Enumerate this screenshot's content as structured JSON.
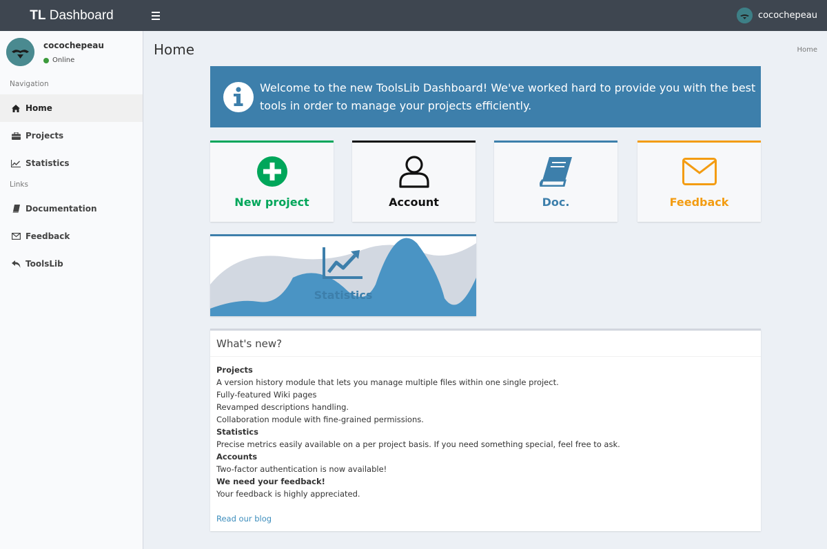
{
  "topbar": {
    "brand_bold": "TL",
    "brand_rest": " Dashboard",
    "username": "cocochepeau",
    "menu_icon": "hamburger-icon"
  },
  "sidebar": {
    "user": {
      "name": "cocochepeau",
      "status": "Online",
      "status_color": "#3c9a3c"
    },
    "nav_header": "Navigation",
    "nav_items": [
      {
        "label": "Home",
        "icon": "home-icon",
        "active": true
      },
      {
        "label": "Projects",
        "icon": "briefcase-icon"
      },
      {
        "label": "Statistics",
        "icon": "line-chart-icon"
      }
    ],
    "links_header": "Links",
    "link_items": [
      {
        "label": "Documentation",
        "icon": "book-icon"
      },
      {
        "label": "Feedback",
        "icon": "envelope-icon"
      },
      {
        "label": "ToolsLib",
        "icon": "reply-icon"
      }
    ]
  },
  "page": {
    "title": "Home",
    "breadcrumb": "Home"
  },
  "welcome": {
    "line1": "Welcome to the new ToolsLib Dashboard! We've worked hard to provide you with the best",
    "line2": "tools in order to manage your projects efficiently.",
    "icon": "info-circle-icon",
    "color": "#3d7fab"
  },
  "cards": [
    {
      "label": "New project",
      "icon": "plus-circle-icon",
      "color": "#00a65a"
    },
    {
      "label": "Account",
      "icon": "user-icon",
      "color": "#111111"
    },
    {
      "label": "Doc.",
      "icon": "book-icon",
      "color": "#3d7fab"
    },
    {
      "label": "Feedback",
      "icon": "envelope-icon",
      "color": "#f39c12"
    }
  ],
  "stats_card": {
    "label": "Statistics",
    "icon": "area-chart-icon",
    "color": "#3d7fab"
  },
  "news": {
    "title": "What's new?",
    "sections": [
      {
        "heading": "Projects",
        "lines": [
          "A version history module that lets you manage multiple files within one single project.",
          "Fully-featured Wiki pages",
          "Revamped descriptions handling.",
          "Collaboration module with fine-grained permissions."
        ]
      },
      {
        "heading": "Statistics",
        "lines": [
          "Precise metrics easily available on a per project basis. If you need something special, feel free to ask."
        ]
      },
      {
        "heading": "Accounts",
        "lines": [
          "Two-factor authentication is now available!"
        ]
      },
      {
        "heading": "We need your feedback!",
        "lines": [
          "Your feedback is highly appreciated."
        ]
      }
    ],
    "link": "Read our blog"
  }
}
